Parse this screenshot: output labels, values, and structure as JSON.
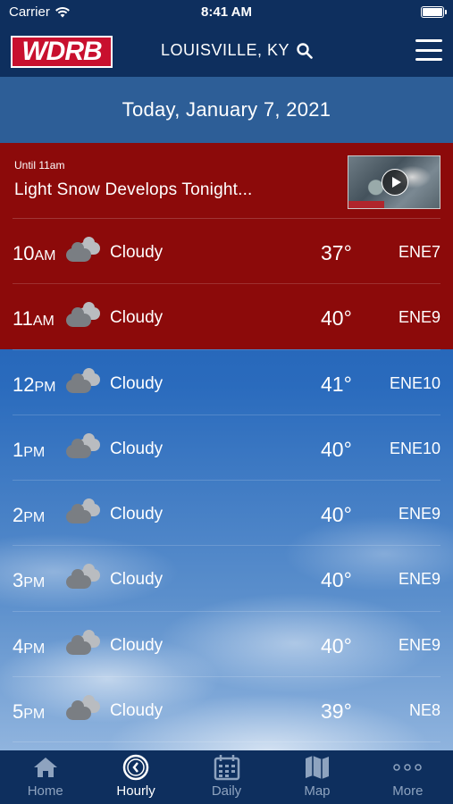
{
  "status_bar": {
    "carrier": "Carrier",
    "time": "8:41 AM"
  },
  "header": {
    "logo_text": "WDRB",
    "location": "LOUISVILLE, KY"
  },
  "date_bar": {
    "label": "Today, January 7, 2021"
  },
  "alert": {
    "until": "Until 11am",
    "headline": "Light Snow Develops Tonight..."
  },
  "hourly": [
    {
      "hour": "10",
      "ampm": "AM",
      "condition": "Cloudy",
      "temp": "37°",
      "wind": "ENE7",
      "icon": "cloudy-icon"
    },
    {
      "hour": "11",
      "ampm": "AM",
      "condition": "Cloudy",
      "temp": "40°",
      "wind": "ENE9",
      "icon": "cloudy-icon"
    },
    {
      "hour": "12",
      "ampm": "PM",
      "condition": "Cloudy",
      "temp": "41°",
      "wind": "ENE10",
      "icon": "cloudy-icon"
    },
    {
      "hour": "1",
      "ampm": "PM",
      "condition": "Cloudy",
      "temp": "40°",
      "wind": "ENE10",
      "icon": "cloudy-icon"
    },
    {
      "hour": "2",
      "ampm": "PM",
      "condition": "Cloudy",
      "temp": "40°",
      "wind": "ENE9",
      "icon": "cloudy-icon"
    },
    {
      "hour": "3",
      "ampm": "PM",
      "condition": "Cloudy",
      "temp": "40°",
      "wind": "ENE9",
      "icon": "cloudy-icon"
    },
    {
      "hour": "4",
      "ampm": "PM",
      "condition": "Cloudy",
      "temp": "40°",
      "wind": "ENE9",
      "icon": "cloudy-icon"
    },
    {
      "hour": "5",
      "ampm": "PM",
      "condition": "Cloudy",
      "temp": "39°",
      "wind": "NE8",
      "icon": "cloudy-icon"
    }
  ],
  "tabs": [
    {
      "label": "Home",
      "icon": "home-icon",
      "active": false
    },
    {
      "label": "Hourly",
      "icon": "clock-icon",
      "active": true
    },
    {
      "label": "Daily",
      "icon": "calendar-icon",
      "active": false
    },
    {
      "label": "Map",
      "icon": "map-icon",
      "active": false
    },
    {
      "label": "More",
      "icon": "more-icon",
      "active": false
    }
  ],
  "colors": {
    "navy": "#0e2f5e",
    "alert_red": "#8c0a0a",
    "date_bar": "#2d5e97",
    "logo_red": "#c8102e"
  }
}
